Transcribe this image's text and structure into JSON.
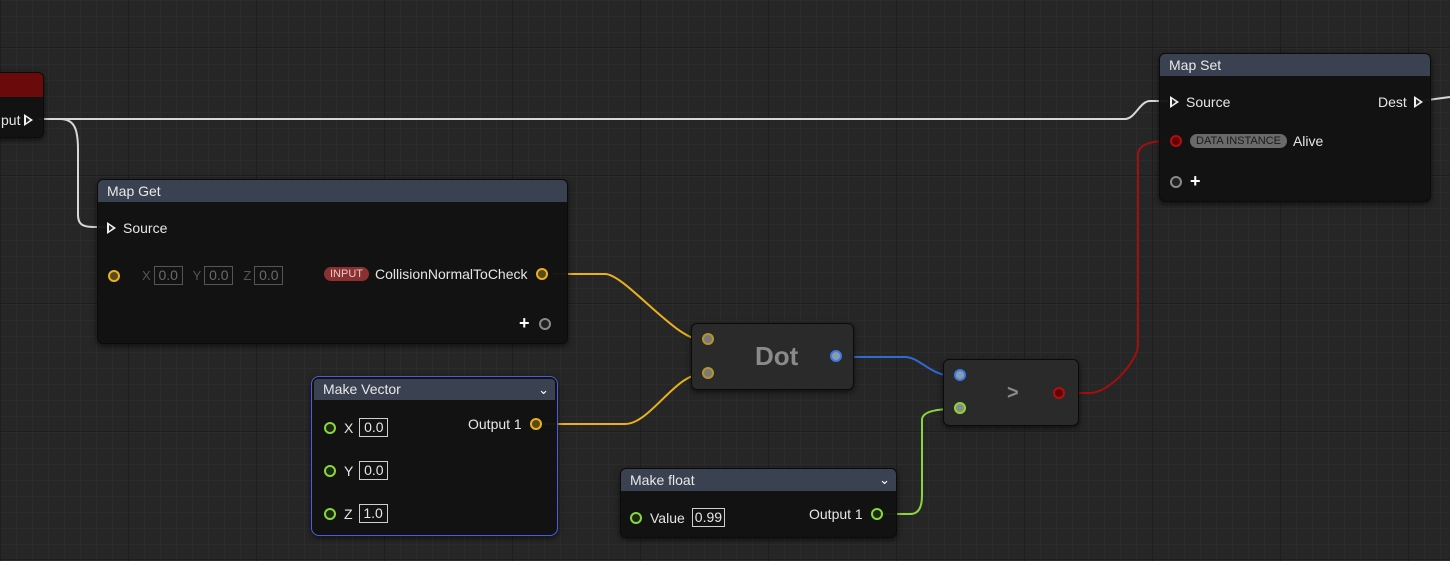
{
  "graph": {
    "wire_colors": {
      "exec": "#d8d8d8",
      "vector": "#e9b01f",
      "float": "#8bd63b",
      "dot_out": "#2f6bd6",
      "bool": "#a01010"
    }
  },
  "left_node": {
    "exec_label": "put"
  },
  "map_get": {
    "title": "Map Get",
    "source_label": "Source",
    "x_axis": "X",
    "x_value": "0.0",
    "y_axis": "Y",
    "y_value": "0.0",
    "z_axis": "Z",
    "z_value": "0.0",
    "badge": "INPUT",
    "param_label": "CollisionNormalToCheck",
    "add_pin": "+"
  },
  "map_set": {
    "title": "Map Set",
    "source_label": "Source",
    "dest_label": "Dest",
    "badge": "DATA INSTANCE",
    "param_label": "Alive",
    "add_pin": "+"
  },
  "make_vector": {
    "title": "Make Vector",
    "x_label": "X",
    "x_value": "0.0",
    "y_label": "Y",
    "y_value": "0.0",
    "z_label": "Z",
    "z_value": "1.0",
    "output_label": "Output 1",
    "chevron_icon": "chevron-down-icon"
  },
  "dot": {
    "title": "Dot"
  },
  "greater": {
    "title": ">"
  },
  "make_float": {
    "title": "Make float",
    "value_label": "Value",
    "value": "0.99",
    "output_label": "Output 1",
    "chevron_icon": "chevron-down-icon"
  }
}
